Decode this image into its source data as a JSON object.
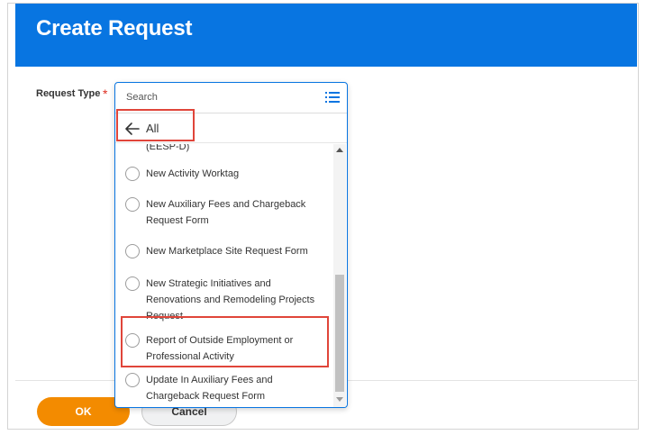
{
  "header": {
    "title": "Create Request"
  },
  "form": {
    "field_label": "Request Type",
    "required_marker": "*"
  },
  "dropdown": {
    "search_placeholder": "Search",
    "back_label": "All",
    "options": [
      {
        "label": "(EESP-D)"
      },
      {
        "label": "New Activity Worktag"
      },
      {
        "label": "New Auxiliary Fees and Chargeback Request Form"
      },
      {
        "label": "New Marketplace Site Request Form"
      },
      {
        "label": "New Strategic Initiatives and Renovations and Remodeling Projects Request"
      },
      {
        "label": "Report of Outside Employment or Professional Activity"
      },
      {
        "label": "Update In Auxiliary Fees and Chargeback Request Form"
      }
    ]
  },
  "footer": {
    "ok_label": "OK",
    "cancel_label": "Cancel"
  },
  "colors": {
    "header_blue": "#0875e1",
    "ok_orange": "#f38b00",
    "highlight_red": "#e0453a",
    "required_red": "#de2e21"
  }
}
